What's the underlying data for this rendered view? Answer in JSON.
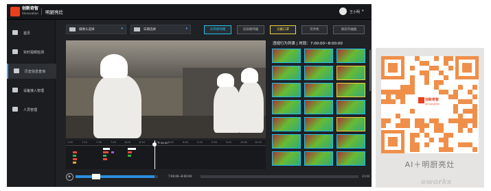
{
  "header": {
    "brand_name": "创新奇智",
    "brand_sub": "AInnovation",
    "app_title": "明厨亮灶",
    "user_name": "王小明"
  },
  "sidebar": {
    "items": [
      {
        "label": "首页",
        "icon": "home-icon",
        "active": false
      },
      {
        "label": "实时视频检测",
        "icon": "camera-icon",
        "active": false
      },
      {
        "label": "历史信息查询",
        "icon": "document-icon",
        "active": true
      },
      {
        "label": "设备接入管理",
        "icon": "monitor-icon",
        "active": false
      },
      {
        "label": "人员管理",
        "icon": "person-icon",
        "active": false
      }
    ]
  },
  "toolbar": {
    "camera_select": "摄像头选择",
    "date_select": "日期选择",
    "buttons": [
      {
        "label": "没带厨师帽",
        "style": "blue"
      },
      {
        "label": "没穿厨师服",
        "style": "gray"
      },
      {
        "label": "没戴口罩",
        "style": "yellow"
      },
      {
        "label": "玩手机",
        "style": "gray"
      },
      {
        "label": "厨房内抽烟",
        "style": "gray"
      }
    ]
  },
  "player": {
    "timeline_ticks": [
      "7:00",
      "7:15",
      "7:30",
      "7:45",
      "8:00",
      "8:15",
      "8:30",
      "8:45",
      "9:00",
      "9:15",
      "9:30",
      "9:45",
      "10:00",
      "10:15"
    ],
    "cursor_time": "7:34:00",
    "range_label": "7:00:00~8:00:00",
    "end_label": "24:00"
  },
  "violations": {
    "title": "违规行为列表  |  时段：7:00:00~8:00:00",
    "thumb_border": [
      "blue",
      "blue",
      "blue",
      "blue",
      "blue",
      "yellow",
      "blue",
      "blue",
      "yellow",
      "blue",
      "blue",
      "blue",
      "blue",
      "blue",
      "yellow",
      "blue",
      "blue",
      "blue",
      "blue",
      "blue",
      "blue"
    ]
  },
  "qr": {
    "logo_name": "创新奇智",
    "logo_sub": "AInnovation",
    "caption": "AI＋明厨亮灶"
  },
  "watermark": "eworks",
  "colors": {
    "accent_blue": "#1ec3f0",
    "accent_yellow": "#f0d23c",
    "brand_orange": "#e8401e",
    "qr_orange": "#ef8f4a"
  }
}
